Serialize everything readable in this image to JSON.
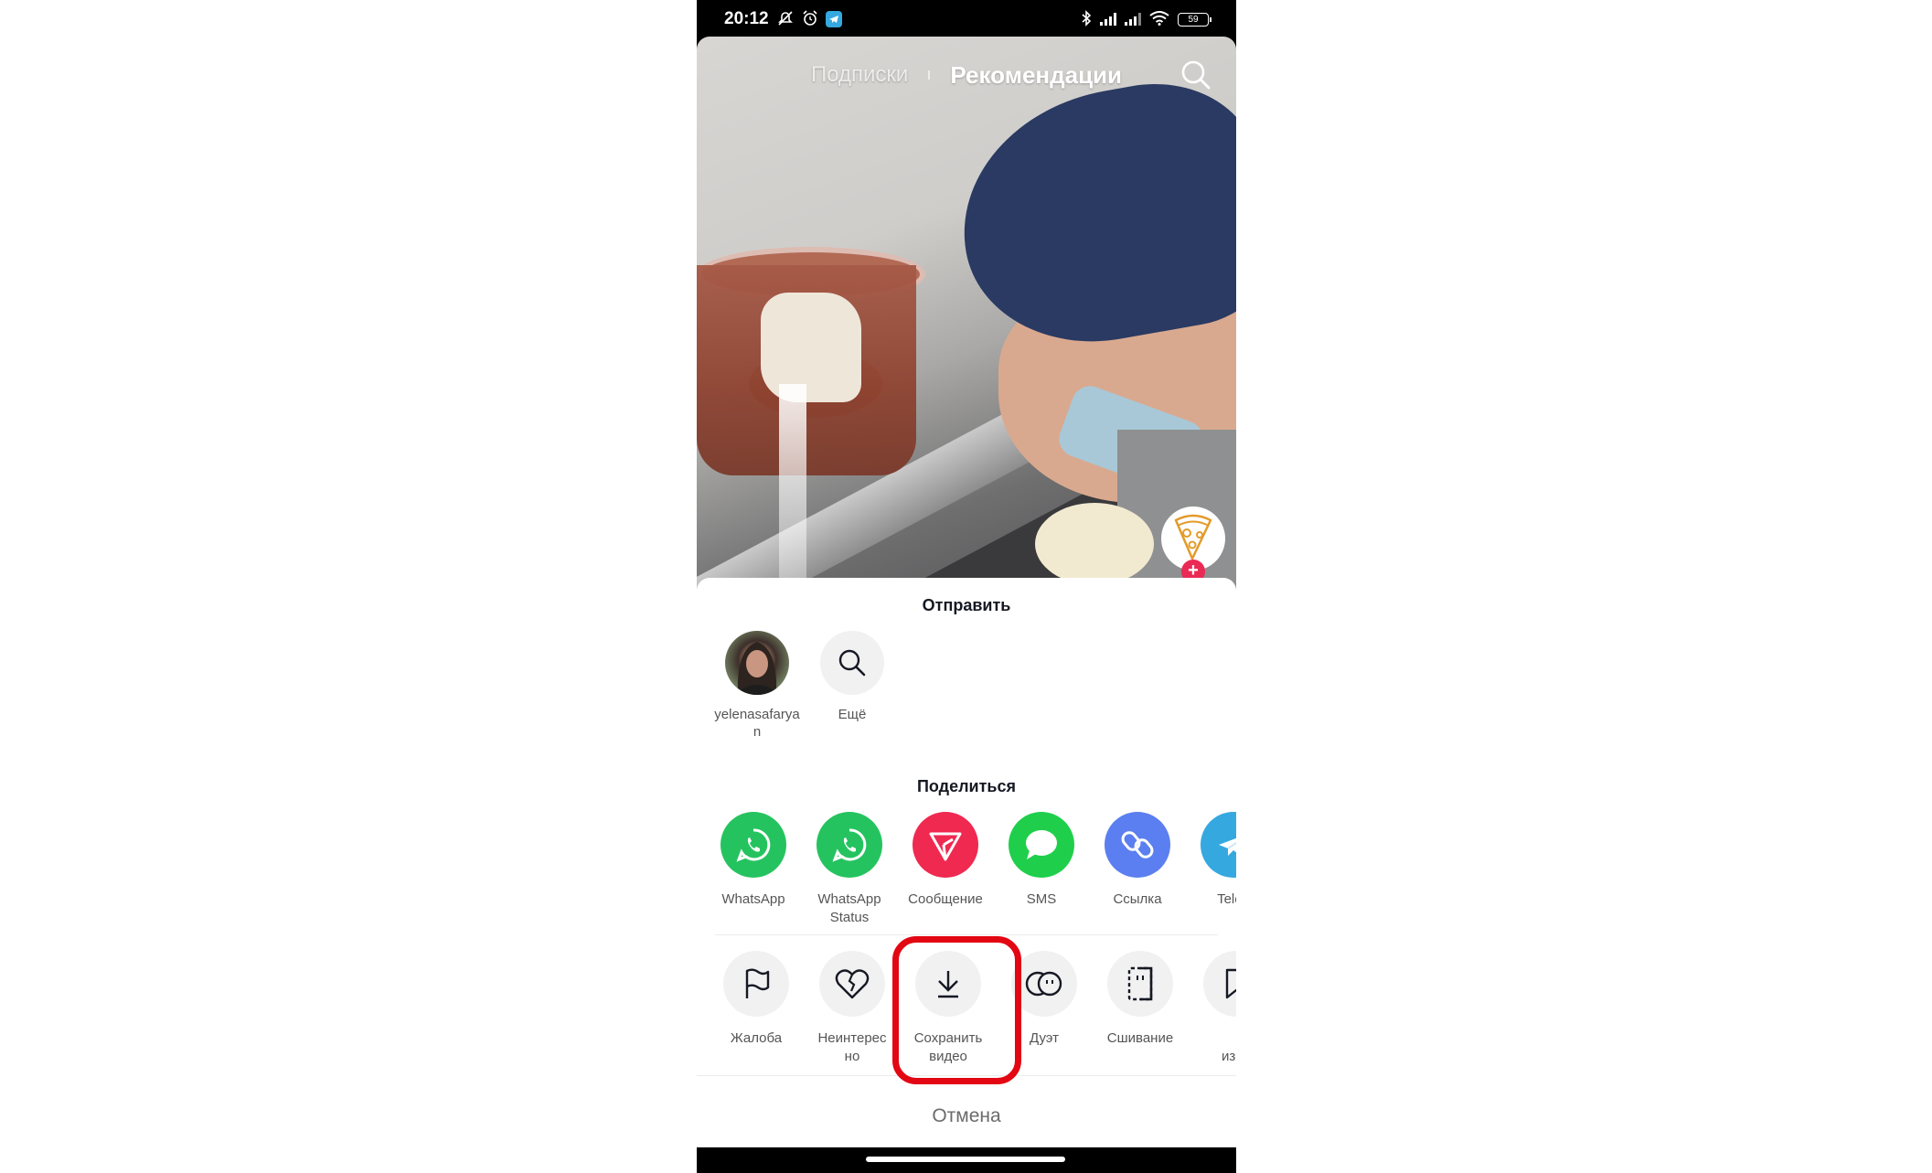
{
  "status_bar": {
    "time": "20:12",
    "left_icons": [
      "muted-bell-icon",
      "alarm-icon",
      "telegram-notification-icon"
    ],
    "right_icons": [
      "bluetooth-icon",
      "signal-icon",
      "signal-icon",
      "wifi-icon",
      "battery-icon"
    ],
    "battery_level": "59"
  },
  "feed": {
    "tabs": [
      {
        "label": "Подписки",
        "active": false
      },
      {
        "label": "Рекомендации",
        "active": true
      }
    ],
    "search_icon": "search-icon",
    "creator_avatar_icon": "pizza-slice-icon",
    "follow_label": "+"
  },
  "share_sheet": {
    "send_title": "Отправить",
    "contacts": [
      {
        "label": "yelenasafaryan",
        "type": "user-avatar"
      },
      {
        "label": "Ещё",
        "type": "search-icon"
      }
    ],
    "share_title": "Поделиться",
    "apps": [
      {
        "label": "WhatsApp",
        "icon": "whatsapp-icon",
        "color": "#25c35f"
      },
      {
        "label": "WhatsApp Status",
        "icon": "whatsapp-icon",
        "color": "#25c35f"
      },
      {
        "label": "Сообщение",
        "icon": "send-message-icon",
        "color": "#ef2950"
      },
      {
        "label": "SMS",
        "icon": "sms-bubble-icon",
        "color": "#1fcf4b"
      },
      {
        "label": "Ссылка",
        "icon": "link-icon",
        "color": "#5b7ff0"
      },
      {
        "label": "Teleg",
        "icon": "telegram-icon",
        "color": "#35a8e0"
      }
    ],
    "actions": [
      {
        "label": "Жалоба",
        "icon": "flag-icon"
      },
      {
        "label": "Неинтерес но",
        "icon": "broken-heart-icon"
      },
      {
        "label": "Сохранить видео",
        "icon": "download-icon",
        "highlighted": true
      },
      {
        "label": "Дуэт",
        "icon": "duet-icon"
      },
      {
        "label": "Сшивание",
        "icon": "stitch-icon"
      },
      {
        "label": "избр",
        "icon": "bookmark-icon"
      }
    ],
    "cancel_label": "Отмена"
  },
  "colors": {
    "highlight_border": "#e30613",
    "follow_badge": "#ea2a55"
  }
}
